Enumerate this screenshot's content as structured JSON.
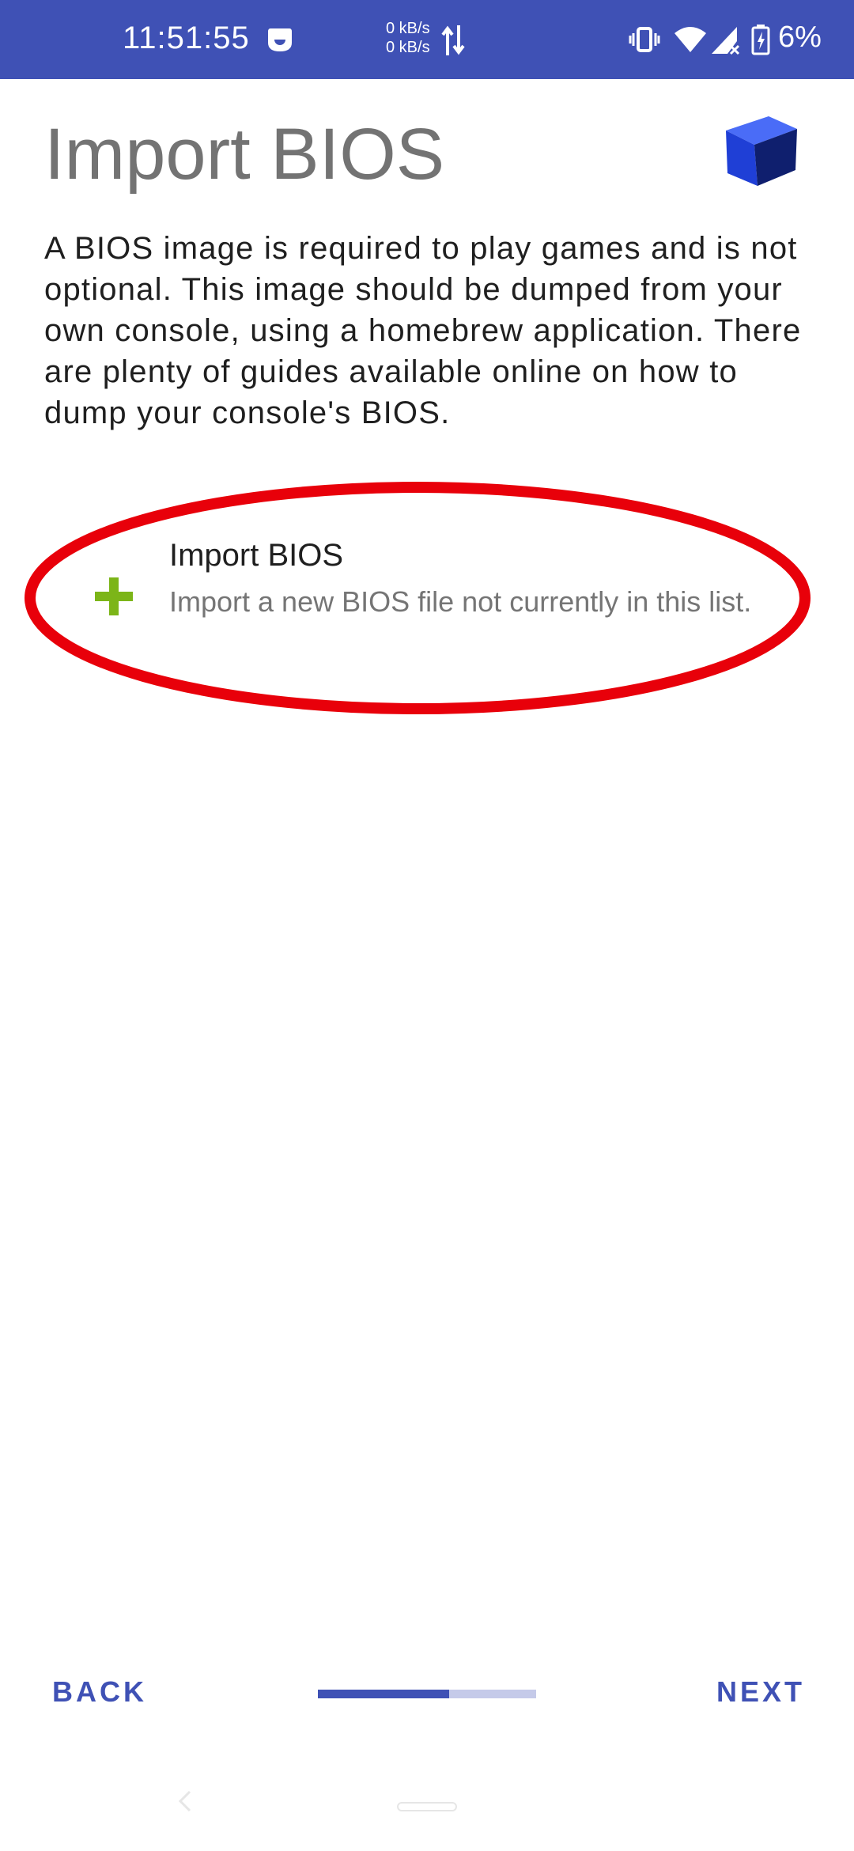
{
  "status_bar": {
    "time": "11:51:55",
    "net_up": "0 kB/s",
    "net_down": "0 kB/s",
    "battery_percent": "6%",
    "icons": [
      "app-notification-icon",
      "data-arrows-icon",
      "vibrate-icon",
      "wifi-icon",
      "signal-icon",
      "battery-charging-icon"
    ],
    "background_color": "#3f51b5"
  },
  "header": {
    "title": "Import BIOS",
    "logo_icon": "cube-logo-icon"
  },
  "description": "A BIOS image is required to play games and is not optional. This image should be dumped from your own console, using a homebrew application. There are plenty of guides available online on how to dump your console's BIOS.",
  "list": {
    "items": [
      {
        "icon": "plus-icon",
        "title": "Import BIOS",
        "subtitle": "Import a new BIOS file not currently in this list."
      }
    ]
  },
  "annotation": {
    "highlight_color": "#e8000a"
  },
  "bottom_nav": {
    "back_label": "BACK",
    "next_label": "NEXT",
    "progress": 0.6,
    "accent_color": "#3f51b5",
    "track_color": "#c5cae9"
  },
  "system_nav": {
    "icons": [
      "system-back-icon",
      "home-pill-icon"
    ]
  }
}
